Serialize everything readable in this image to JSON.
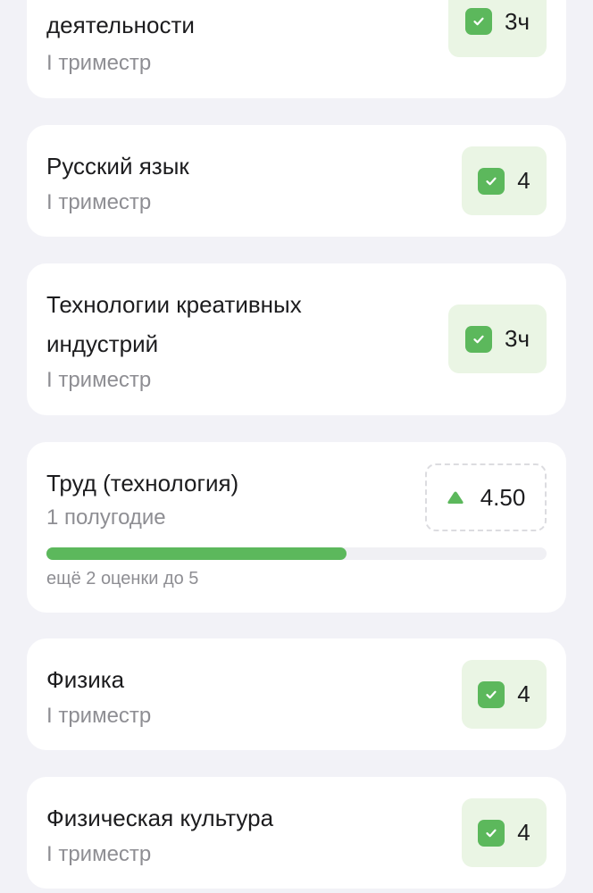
{
  "subjects": [
    {
      "title_line2": "деятельности",
      "period": "I триместр",
      "grade": "3ч"
    },
    {
      "title": "Русский язык",
      "period": "I триместр",
      "grade": "4"
    },
    {
      "title_line1": "Технологии креативных",
      "title_line2": "индустрий",
      "period": "I триместр",
      "grade": "3ч"
    },
    {
      "title": "Труд (технология)",
      "period": "1 полугодие",
      "average": "4.50",
      "progress_fraction": 0.6,
      "hint": "ещё 2 оценки до 5"
    },
    {
      "title": "Физика",
      "period": "I триместр",
      "grade": "4"
    },
    {
      "title": "Физическая культура",
      "period": "I триместр",
      "grade": "4"
    }
  ],
  "colors": {
    "accent_green": "#5cb85c",
    "grade_bg": "#eaf5e4",
    "muted": "#8e8e93"
  },
  "icons": {
    "grade_check": "check-square-icon",
    "trend": "triangle-up-icon"
  }
}
